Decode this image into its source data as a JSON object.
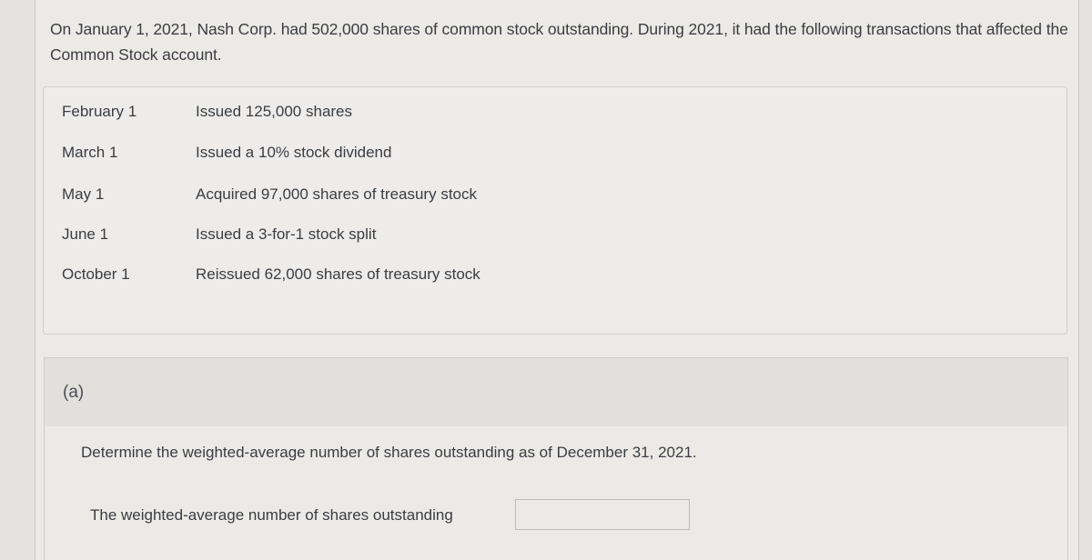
{
  "problem": {
    "intro": "On January 1, 2021, Nash Corp. had 502,000 shares of common stock outstanding. During 2021, it had the following transactions that affected the Common Stock account.",
    "transactions": [
      {
        "date": "February 1",
        "description": "Issued 125,000 shares"
      },
      {
        "date": "March 1",
        "description": "Issued a 10% stock dividend"
      },
      {
        "date": "May 1",
        "description": "Acquired 97,000 shares of treasury stock"
      },
      {
        "date": "June 1",
        "description": "Issued a 3-for-1 stock split"
      },
      {
        "date": "October 1",
        "description": "Reissued 62,000 shares of treasury stock"
      }
    ]
  },
  "part_a": {
    "label": "(a)",
    "question": "Determine the weighted-average number of shares outstanding as of December 31, 2021.",
    "answer_label": "The weighted-average number of shares outstanding",
    "answer_value": "",
    "answer_placeholder": ""
  }
}
